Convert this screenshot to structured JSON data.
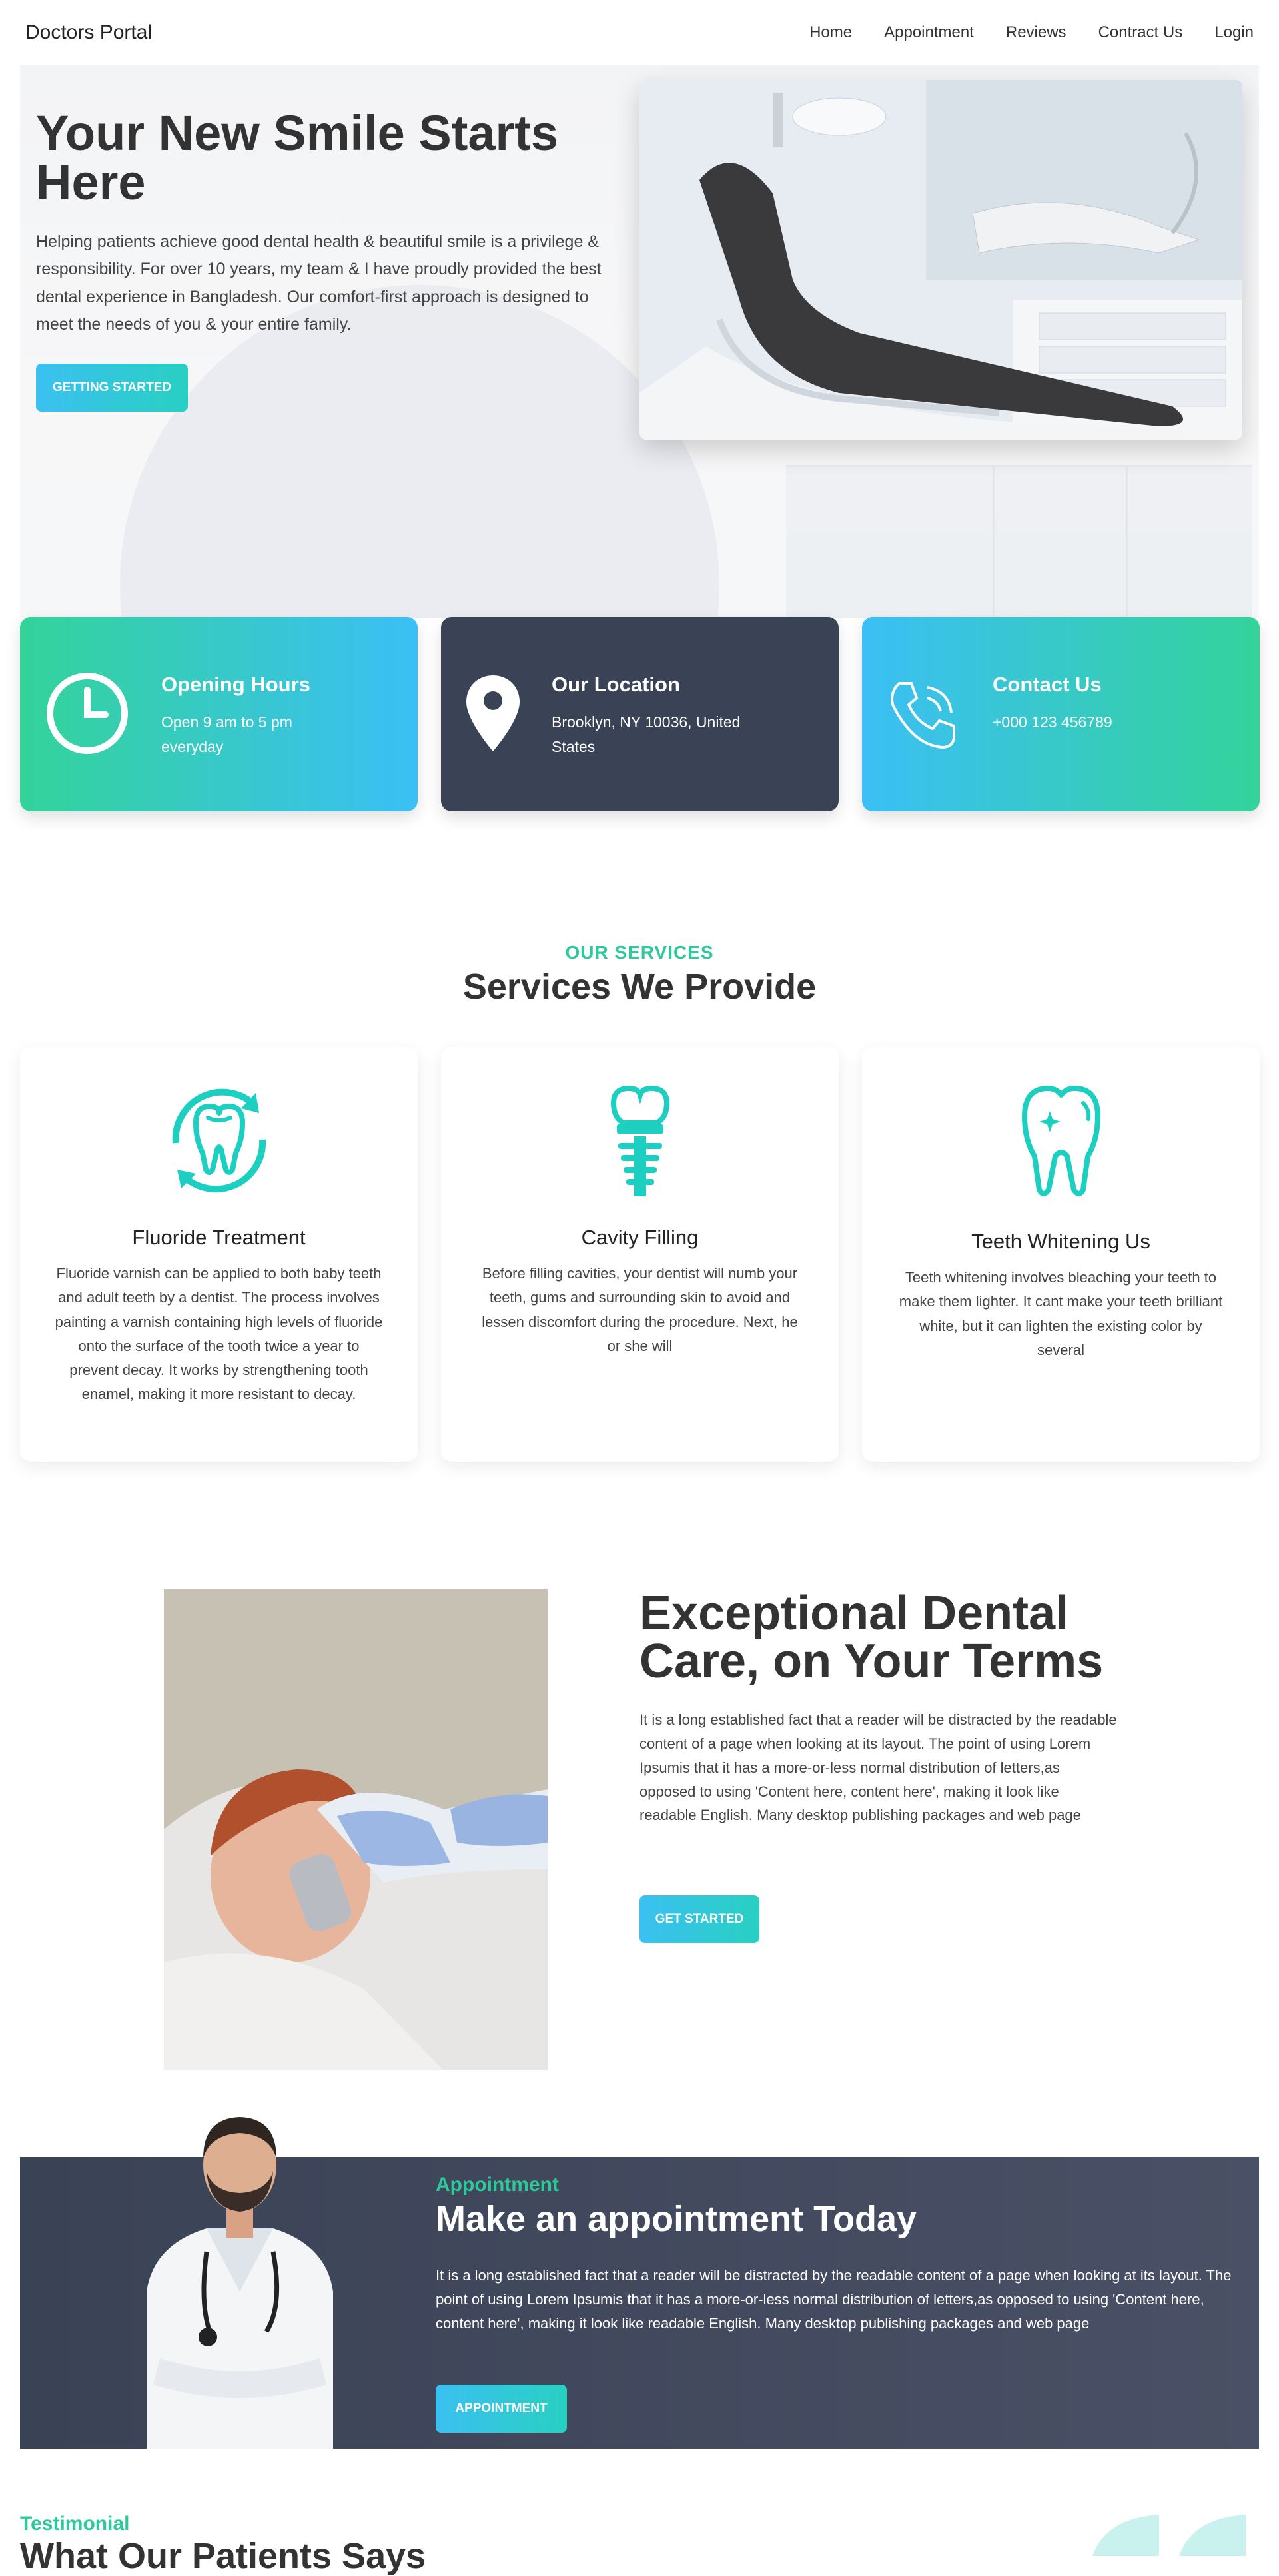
{
  "nav": {
    "brand": "Doctors Portal",
    "links": [
      "Home",
      "Appointment",
      "Reviews",
      "Contract Us",
      "Login"
    ]
  },
  "hero": {
    "title": "Your New Smile Starts Here",
    "text": "Helping patients achieve good dental health & beautiful smile is a privilege & responsibility. For over 10 years, my team & I have proudly provided the best dental experience in Bangladesh. Our comfort-first approach is designed to meet the needs of you & your entire family.",
    "button": "GETTING STARTED",
    "image_icon": "dental-chair-photo"
  },
  "info_cards": [
    {
      "title": "Opening Hours",
      "text": "Open 9 am to 5 pm everyday",
      "icon": "clock-icon"
    },
    {
      "title": "Our Location",
      "text": "Brooklyn, NY 10036, United States",
      "icon": "map-pin-icon"
    },
    {
      "title": "Contact Us",
      "text": "+000 123 456789",
      "icon": "phone-icon"
    }
  ],
  "services": {
    "kicker": "OUR SERVICES",
    "title": "Services We Provide",
    "items": [
      {
        "title": "Fluoride Treatment",
        "text": "Fluoride varnish can be applied to both baby teeth and adult teeth by a dentist. The process involves painting a varnish containing high levels of fluoride onto the surface of the tooth twice a year to prevent decay. It works by strengthening tooth enamel, making it more resistant to decay.",
        "icon": "fluoride-tooth-icon"
      },
      {
        "title": "Cavity Filling",
        "text": "Before filling cavities, your dentist will numb your teeth, gums and surrounding skin to avoid and lessen discomfort during the procedure. Next, he or she will",
        "icon": "dental-implant-icon"
      },
      {
        "title": "Teeth Whitening Us",
        "text": "Teeth whitening involves bleaching your teeth to make them lighter. It cant make your teeth brilliant white, but it can lighten the existing color by several",
        "icon": "sparkling-tooth-icon"
      }
    ]
  },
  "exceptional": {
    "title": "Exceptional Dental Care, on Your Terms",
    "text": "It is a long established fact that a reader will be distracted by the readable content of a page when looking at its layout. The point of using Lorem Ipsumis that it has a more-or-less normal distribution of letters,as opposed to using 'Content here, content here', making it look like readable English. Many desktop publishing packages and web page",
    "button": "GET STARTED"
  },
  "appointment": {
    "kicker": "Appointment",
    "title": "Make an appointment Today",
    "text": "It is a long established fact that a reader will be distracted by the readable content of a page when looking at its layout. The point of using Lorem Ipsumis that it has a more-or-less normal distribution of letters,as opposed to using 'Content here, content here', making it look like readable English. Many desktop publishing packages and web page",
    "button": "APPOINTMENT"
  },
  "testimonial": {
    "kicker": "Testimonial",
    "title": "What Our Patients Says"
  },
  "colors": {
    "accent_green": "#2ec99a",
    "accent_blue": "#3bbff5",
    "dark": "#3a4256"
  }
}
